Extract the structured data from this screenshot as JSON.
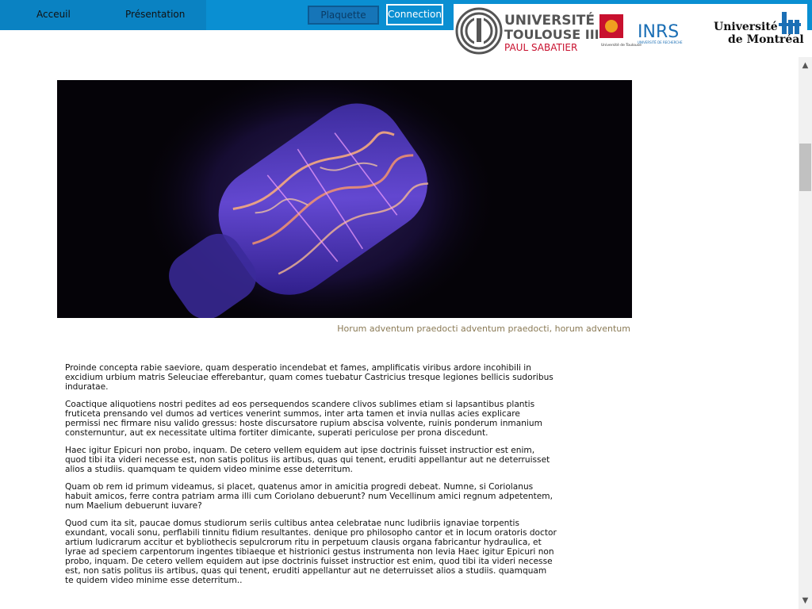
{
  "nav": {
    "accueil": "Acceuil",
    "presentation": "Présentation",
    "plaquette": "Plaquette",
    "connection": "Connection"
  },
  "logos": {
    "ut3_line1": "UNIVERSITÉ",
    "ut3_line2": "TOULOUSE III",
    "ut3_line3": "PAUL SABATIER",
    "univ_toulouse": "Université de Toulouse",
    "inrs": "INRS",
    "inrs_sub": "UNIVERSITÉ DE RECHERCHE",
    "montreal_line1": "Université",
    "montreal_line2": "de Montréal"
  },
  "hero": {
    "caption": "Horum adventum praedocti adventum praedocti, horum adventum"
  },
  "article": {
    "paragraphs": [
      "Proinde concepta rabie saeviore, quam desperatio incendebat et fames, amplificatis viribus ardore incohibili in excidium urbium matris Seleuciae efferebantur, quam comes tuebatur Castricius tresque legiones bellicis sudoribus induratae.",
      "Coactique aliquotiens nostri pedites ad eos persequendos scandere clivos sublimes etiam si lapsantibus plantis fruticeta prensando vel dumos ad vertices venerint summos, inter arta tamen et invia nullas acies explicare permissi nec firmare nisu valido gressus: hoste discursatore rupium abscisa volvente, ruinis ponderum inmanium consternuntur, aut ex necessitate ultima fortiter dimicante, superati periculose per prona discedunt.",
      "Haec igitur Epicuri non probo, inquam. De cetero vellem equidem aut ipse doctrinis fuisset instructior est enim, quod tibi ita videri necesse est, non satis politus iis artibus, quas qui tenent, eruditi appellantur aut ne deterruisset alios a studiis. quamquam te quidem video minime esse deterritum.",
      "Quam ob rem id primum videamus, si placet, quatenus amor in amicitia progredi debeat. Numne, si Coriolanus habuit amicos, ferre contra patriam arma illi cum Coriolano debuerunt? num Vecellinum amici regnum adpetentem, num Maelium debuerunt iuvare?",
      "Quod cum ita sit, paucae domus studiorum seriis cultibus antea celebratae nunc ludibriis ignaviae torpentis exundant, vocali sonu, perflabili tinnitu fidium resultantes. denique pro philosopho cantor et in locum oratoris doctor artium ludicrarum accitur et bybliothecis sepulcrorum ritu in perpetuum clausis organa fabricantur hydraulica, et lyrae ad speciem carpentorum ingentes tibiaeque et histrionici gestus instrumenta non levia Haec igitur Epicuri non probo, inquam. De cetero vellem equidem aut ipse doctrinis fuisset instructior est enim, quod tibi ita videri necesse est, non satis politus iis artibus, quas qui tenent, eruditi appellantur aut ne deterruisset alios a studiis. quamquam te quidem video minime esse deterritum.."
    ]
  },
  "colors": {
    "topbar": "#0a8fd2",
    "nav_left": "#0a82c2",
    "caption": "#8a7a55",
    "ut3_red": "#c8102e",
    "inrs_blue": "#1b6fb5"
  }
}
